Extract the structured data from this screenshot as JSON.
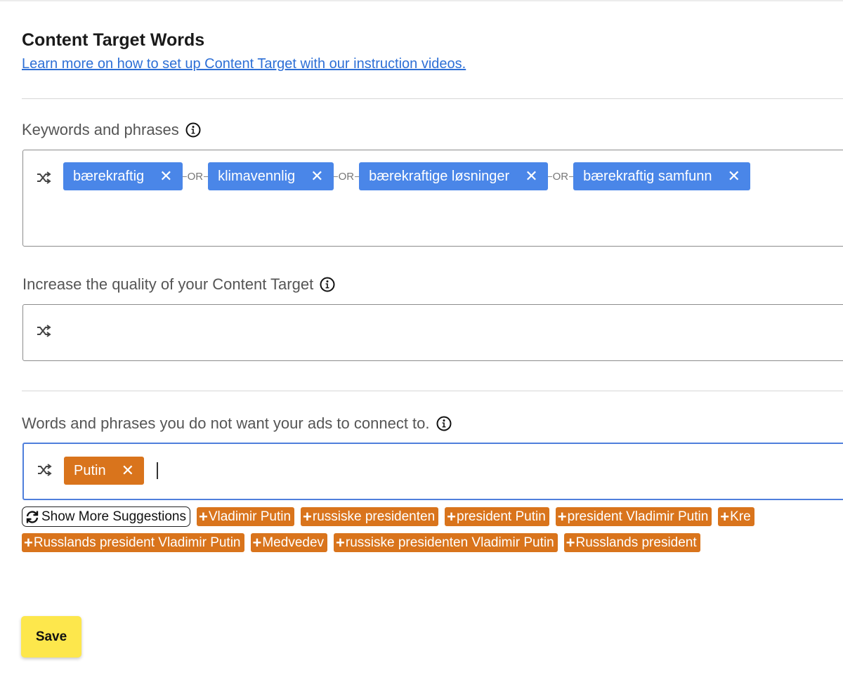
{
  "header": {
    "title": "Content Target Words",
    "learn_link": "Learn more on how to set up Content Target with our instruction videos."
  },
  "keywords": {
    "label": "Keywords and phrases",
    "tags": [
      "bærekraftig",
      "klimavennlig",
      "bærekraftige løsninger",
      "bærekraftig samfunn"
    ],
    "separator": "OR"
  },
  "quality": {
    "label": "Increase the quality of your Content Target"
  },
  "negative": {
    "label": "Words and phrases you do not want your ads to connect to.",
    "tags": [
      "Putin"
    ]
  },
  "suggestions": {
    "show_more_label": "Show More Suggestions",
    "row1": [
      "Vladimir Putin",
      "russiske presidenten",
      "president Putin",
      "president Vladimir Putin",
      "Kre"
    ],
    "row2": [
      "Russlands president Vladimir Putin",
      "Medvedev",
      "russiske presidenten Vladimir Putin",
      "Russlands president"
    ]
  },
  "footer": {
    "save_label": "Save"
  },
  "colors": {
    "tag_blue": "#4a86e8",
    "tag_orange": "#d9741c",
    "link_blue": "#2d6fd6",
    "save_yellow": "#fde74c",
    "focus_border": "#4f7fdc"
  },
  "icons": {
    "info": "info-circle-icon",
    "shuffle": "shuffle-icon",
    "remove": "close-icon",
    "add": "plus-icon",
    "refresh": "refresh-icon"
  }
}
